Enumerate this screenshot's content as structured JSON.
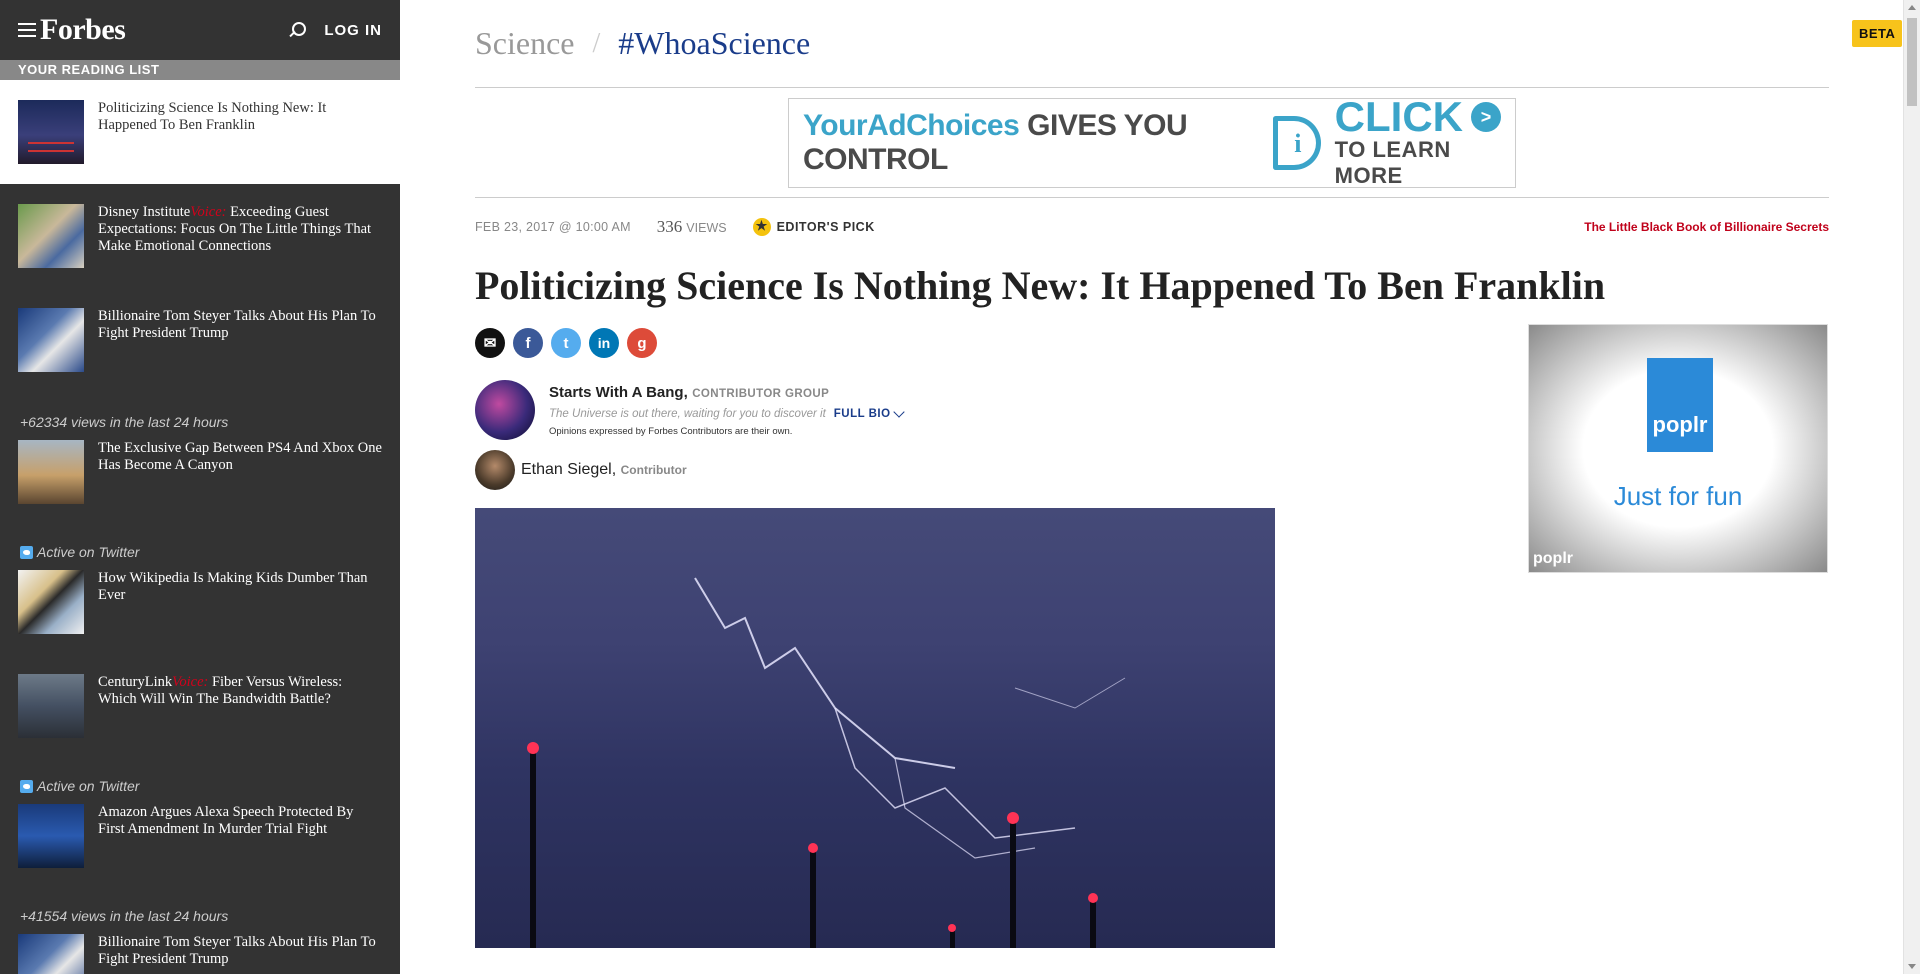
{
  "header": {
    "logo": "Forbes",
    "login": "LOG IN"
  },
  "sidebar": {
    "reading_list_title": "YOUR READING LIST",
    "active_item": {
      "title": "Politicizing Science Is Nothing New: It Happened To Ben Franklin"
    },
    "items": [
      {
        "prefix": "Disney Institute",
        "voice": "Voice:",
        "title": " Exceeding Guest Expectations: Focus On The Little Things That Make Emotional Connections"
      },
      {
        "title": "Billionaire Tom Steyer Talks About His Plan To Fight President Trump"
      },
      {
        "meta": "+62334 views in the last 24 hours",
        "title": "The Exclusive Gap Between PS4 And Xbox One Has Become A Canyon"
      },
      {
        "meta": "Active on Twitter",
        "title": "How Wikipedia Is Making Kids Dumber Than Ever"
      },
      {
        "prefix": "CenturyLink",
        "voice": "Voice:",
        "title": " Fiber Versus Wireless: Which Will Win The Bandwidth Battle?"
      },
      {
        "meta": "Active on Twitter",
        "title": "Amazon Argues Alexa Speech Protected By First Amendment In Murder Trial Fight"
      },
      {
        "meta": "+41554 views in the last 24 hours",
        "title": "Billionaire Tom Steyer Talks About His Plan To Fight President Trump"
      }
    ]
  },
  "section": {
    "category": "Science",
    "separator": "/",
    "tag": "#WhoaScience"
  },
  "ad_banner": {
    "brand": "YourAdChoices",
    "tagline": "GIVES YOU CONTROL",
    "cta": "CLICK",
    "cta_arrow": ">",
    "sub": "TO LEARN MORE"
  },
  "article": {
    "date": "FEB 23, 2017 @ 10:00 AM",
    "views_count": "336",
    "views_label": "VIEWS",
    "editors_pick": "EDITOR'S PICK",
    "promo": "The Little Black Book of Billionaire Secrets",
    "headline": "Politicizing Science Is Nothing New: It Happened To Ben Franklin"
  },
  "share_buttons": {
    "email": "✉",
    "facebook": "f",
    "twitter": "t",
    "linkedin": "in",
    "google": "g"
  },
  "author_group": {
    "name": "Starts With A Bang,",
    "role": "CONTRIBUTOR GROUP",
    "bio": "The Universe is out there, waiting for you to discover it",
    "full_bio": "FULL BIO",
    "opinion": "Opinions expressed by Forbes Contributors are their own."
  },
  "author": {
    "name": "Ethan Siegel,",
    "role": "Contributor"
  },
  "side_ad": {
    "brand": "poplr",
    "tagline": "Just  for fun",
    "mini": "poplr"
  },
  "beta": "BETA",
  "colors": {
    "sidebar_bg": "#333333",
    "brand_blue": "#1a3c8a",
    "promo_red": "#c0021b",
    "beta_yellow": "#f7c31b"
  }
}
